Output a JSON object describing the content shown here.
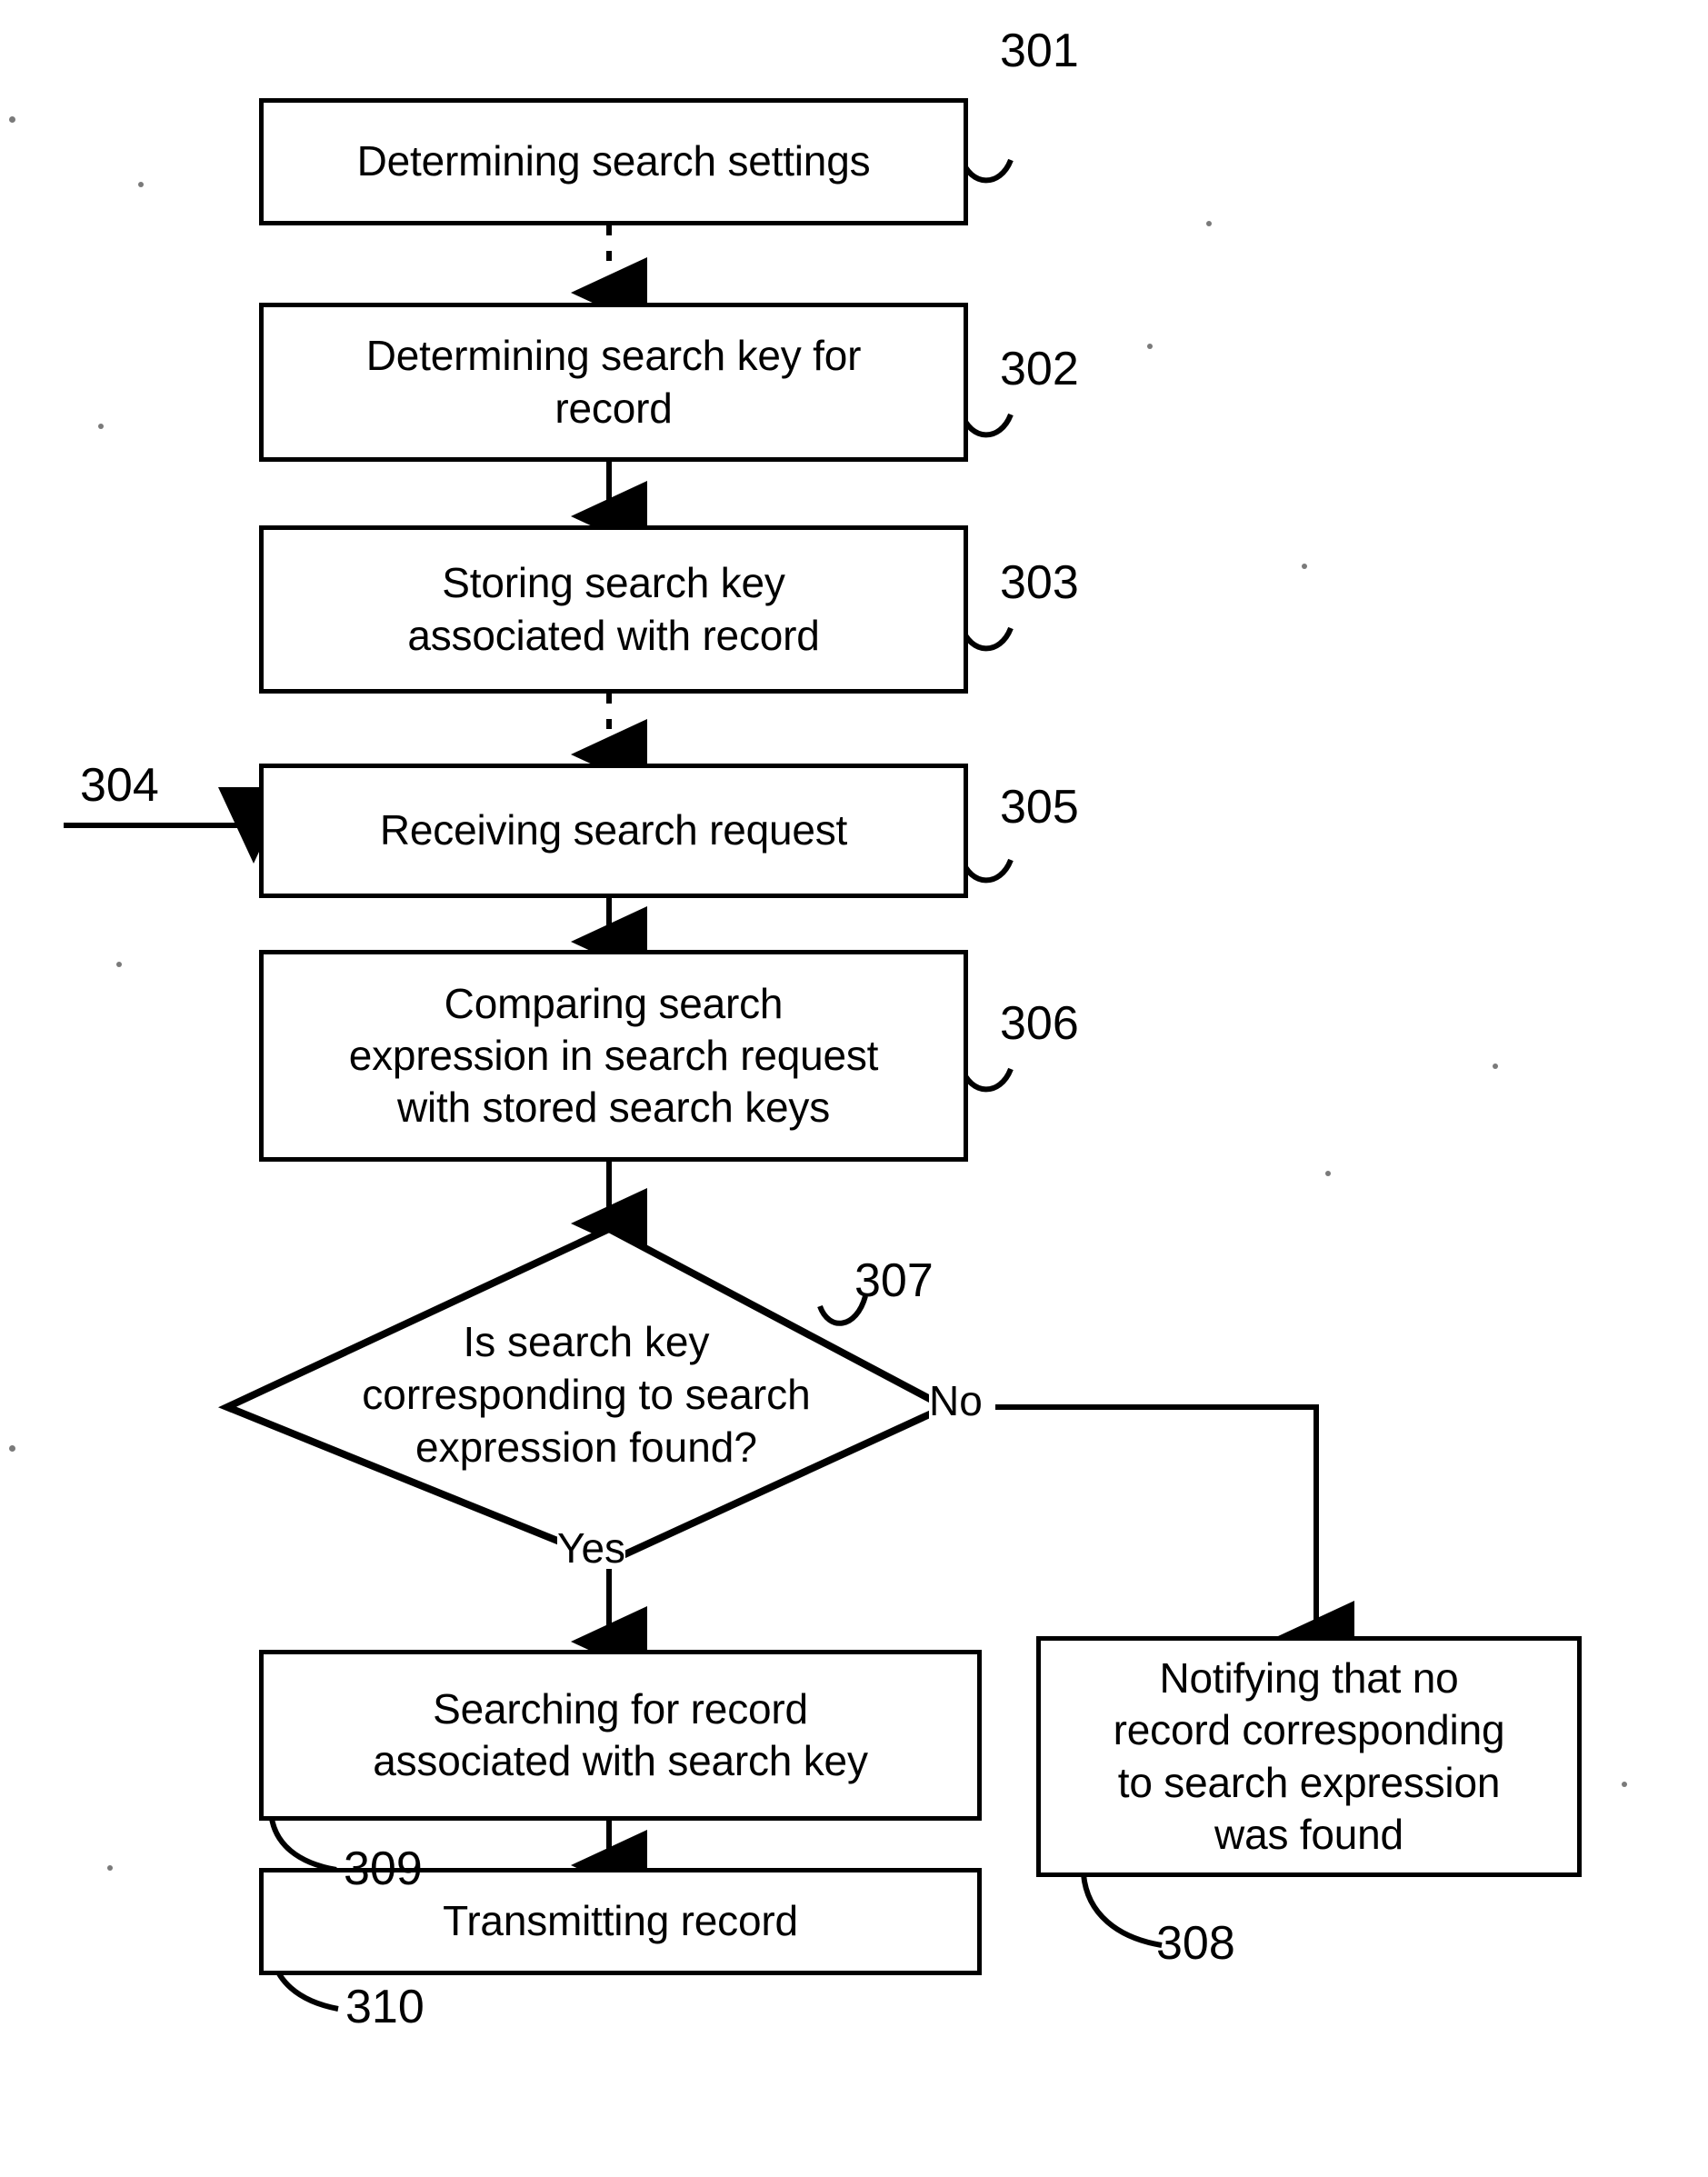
{
  "figure": {
    "title": "Search method flowchart",
    "stroke_color": "#000000",
    "background_color": "#ffffff"
  },
  "nodes": [
    {
      "id": "301",
      "shape": "process",
      "text": "Determining search settings",
      "ref": "301"
    },
    {
      "id": "302",
      "shape": "process",
      "text": "Determining search key for\nrecord",
      "ref": "302"
    },
    {
      "id": "303",
      "shape": "process",
      "text": "Storing search key\nassociated with record",
      "ref": "303"
    },
    {
      "id": "305",
      "shape": "process",
      "text": "Receiving search request",
      "ref": "305"
    },
    {
      "id": "306",
      "shape": "process",
      "text": "Comparing search\nexpression in search request\nwith stored search keys",
      "ref": "306"
    },
    {
      "id": "307",
      "shape": "decision",
      "text": "Is search key\ncorresponding to search\nexpression found?",
      "ref": "307"
    },
    {
      "id": "309",
      "shape": "process",
      "text": "Searching for record\nassociated with search key",
      "ref": "309"
    },
    {
      "id": "310",
      "shape": "process",
      "text": "Transmitting record",
      "ref": "310"
    },
    {
      "id": "308",
      "shape": "process",
      "text": "Notifying that no\nrecord corresponding\nto search expression\nwas found",
      "ref": "308"
    }
  ],
  "branch_labels": {
    "yes": "Yes",
    "no": "No"
  },
  "input_ref": "304",
  "ref_numbers": {
    "r301": "301",
    "r302": "302",
    "r303": "303",
    "r304": "304",
    "r305": "305",
    "r306": "306",
    "r307": "307",
    "r308": "308",
    "r309": "309",
    "r310": "310"
  },
  "node_text": {
    "n301": "Determining search settings",
    "n302": "Determining search key for\nrecord",
    "n303": "Storing search key\nassociated with record",
    "n305": "Receiving search request",
    "n306": "Comparing search\nexpression in search request\nwith stored search keys",
    "n307": "Is search key\ncorresponding to search\nexpression found?",
    "n309": "Searching for record\nassociated with search key",
    "n310": "Transmitting record",
    "n308": "Notifying that no\nrecord corresponding\nto search expression\nwas found"
  }
}
